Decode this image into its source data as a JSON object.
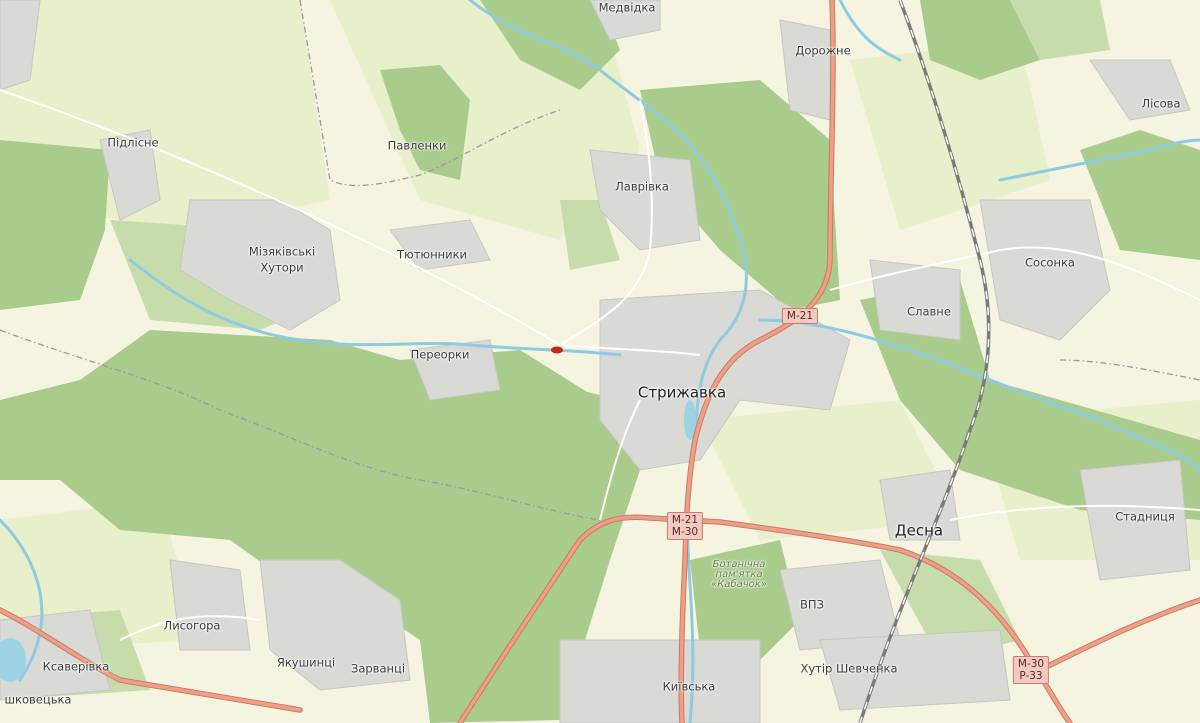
{
  "places": {
    "medvidka": "Медвідка",
    "dorozhne": "Дорожне",
    "lisova": "Лісова",
    "pidlisne": "Підлісне",
    "pavlenky": "Павленки",
    "lavrivka": "Лаврівка",
    "tiutiunnyky": "Тютюнники",
    "miziakivski_1": "Мізяківські",
    "miziakivski_2": "Хутори",
    "sosonka": "Сосонка",
    "slavne": "Славне",
    "pereorky": "Переорки",
    "stryzhavka": "Стрижавка",
    "desna": "Десна",
    "stadnytsia": "Стадниця",
    "vpz": "ВПЗ",
    "lysohora": "Лисогора",
    "kseverivka": "Ксаверівка",
    "yakushyntsi": "Якушинці",
    "zarvantsi": "Зарванці",
    "khutir_shevchenka": "Хутір Шевченка",
    "kyivska": "Київська",
    "lushkovetska": "шковецька"
  },
  "park_label": {
    "line1": "Ботанічна",
    "line2": "пам'ятка",
    "line3": "«Кабачок»"
  },
  "road_shields": {
    "m21_north": [
      "M-21"
    ],
    "m21_m30": [
      "M-21",
      "M-30"
    ],
    "m30_p33": [
      "M-30",
      "P-33"
    ]
  },
  "colors": {
    "base": "#f5f4e0",
    "field": "#eef2d4",
    "forest": "#a6c98a",
    "forest_light": "#c4dca9",
    "settlement": "#dcdcdc",
    "river": "#9ed3e6",
    "major_road": "#e99a7e",
    "railway": "#808080",
    "boundary": "#9b8a9a",
    "marker": "#d0201b"
  }
}
